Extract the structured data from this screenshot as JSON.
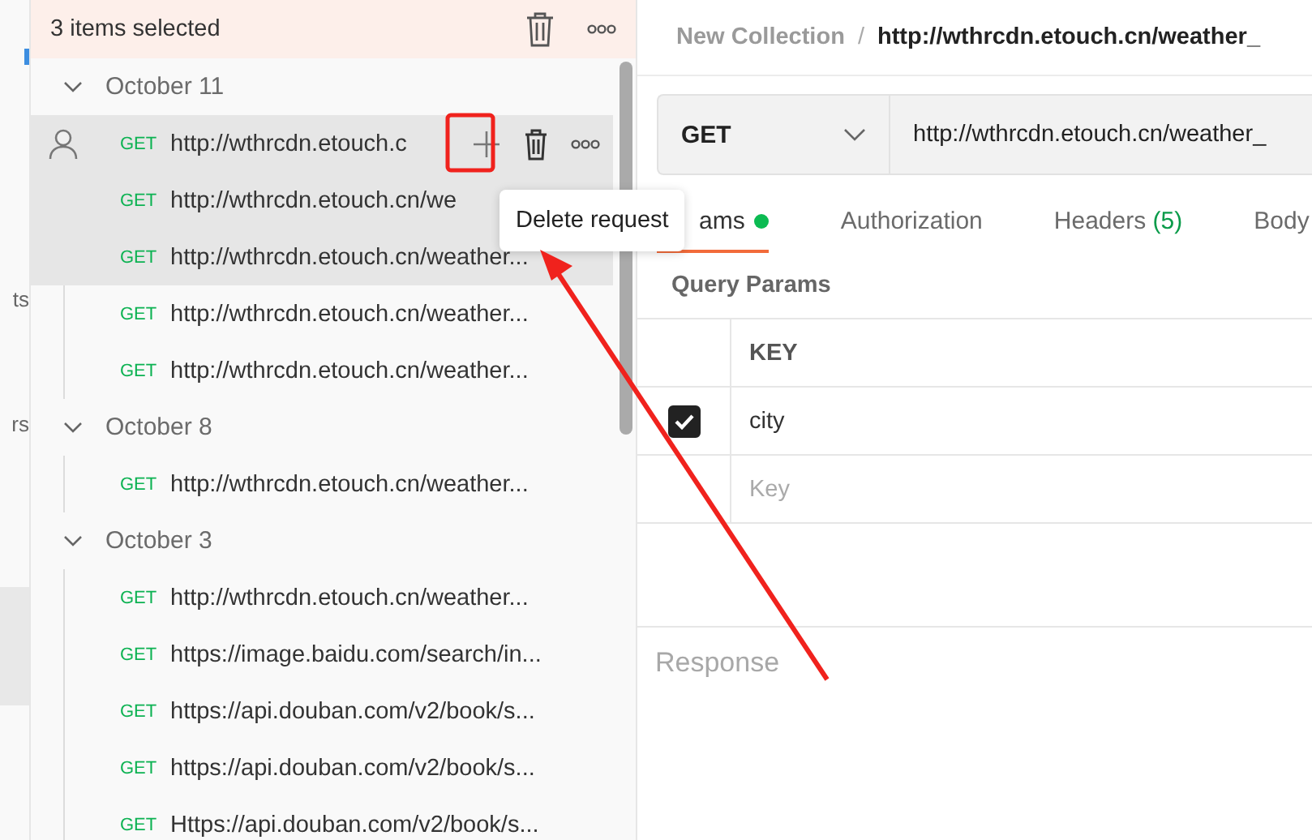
{
  "left_rail": {
    "labels": [
      "ts",
      "rs"
    ]
  },
  "selection_bar": {
    "label": "3 items selected"
  },
  "history": [
    {
      "date": "October 11",
      "expanded": true,
      "requests": [
        {
          "method": "GET",
          "url": "http://wthrcdn.etouch.c",
          "selected": true,
          "hovered": true
        },
        {
          "method": "GET",
          "url": "http://wthrcdn.etouch.cn/we",
          "selected": true,
          "hovered": false
        },
        {
          "method": "GET",
          "url": "http://wthrcdn.etouch.cn/weather...",
          "selected": true,
          "hovered": false
        },
        {
          "method": "GET",
          "url": "http://wthrcdn.etouch.cn/weather...",
          "selected": false,
          "hovered": false
        },
        {
          "method": "GET",
          "url": "http://wthrcdn.etouch.cn/weather...",
          "selected": false,
          "hovered": false
        }
      ]
    },
    {
      "date": "October 8",
      "expanded": true,
      "requests": [
        {
          "method": "GET",
          "url": "http://wthrcdn.etouch.cn/weather...",
          "selected": false,
          "hovered": false
        }
      ]
    },
    {
      "date": "October 3",
      "expanded": true,
      "requests": [
        {
          "method": "GET",
          "url": "http://wthrcdn.etouch.cn/weather...",
          "selected": false,
          "hovered": false
        },
        {
          "method": "GET",
          "url": "https://image.baidu.com/search/in...",
          "selected": false,
          "hovered": false
        },
        {
          "method": "GET",
          "url": "https://api.douban.com/v2/book/s...",
          "selected": false,
          "hovered": false
        },
        {
          "method": "GET",
          "url": "https://api.douban.com/v2/book/s...",
          "selected": false,
          "hovered": false
        },
        {
          "method": "GET",
          "url": "Https://api.douban.com/v2/book/s...",
          "selected": false,
          "hovered": false
        }
      ]
    }
  ],
  "tooltip": "Delete request",
  "breadcrumb": {
    "collection": "New Collection",
    "separator": "/",
    "request": "http://wthrcdn.etouch.cn/weather_"
  },
  "request": {
    "method": "GET",
    "url": "http://wthrcdn.etouch.cn/weather_"
  },
  "tabs": [
    {
      "label": "ams",
      "selected": true,
      "indicator": true
    },
    {
      "label": "Authorization",
      "selected": false,
      "indicator": false
    },
    {
      "label": "Headers",
      "count": "(5)",
      "selected": false,
      "indicator": false
    },
    {
      "label": "Body",
      "selected": false,
      "indicator": false
    }
  ],
  "params": {
    "title": "Query Params",
    "columns": [
      "KEY"
    ],
    "rows": [
      {
        "key": "city",
        "checked": true
      }
    ],
    "placeholder": "Key"
  },
  "response": {
    "title": "Response"
  }
}
